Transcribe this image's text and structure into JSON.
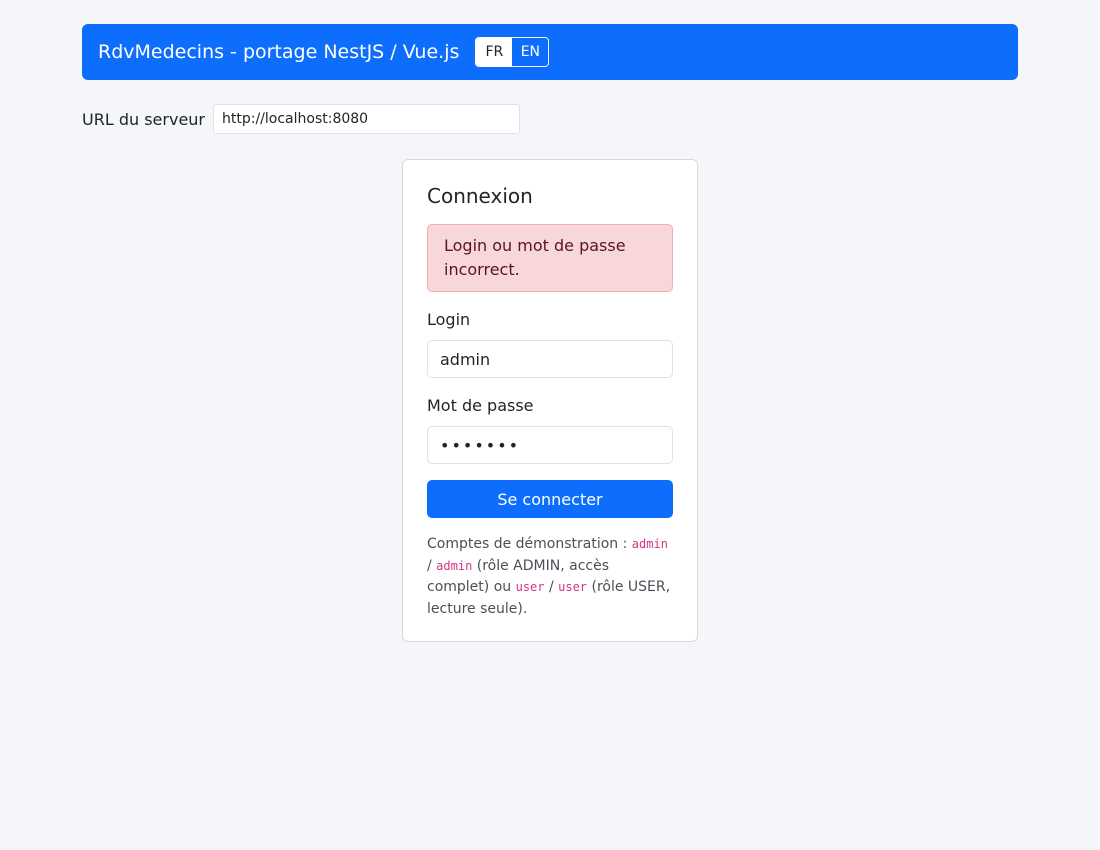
{
  "header": {
    "title": "RdvMedecins - portage NestJS / Vue.js",
    "languages": [
      "FR",
      "EN"
    ],
    "active_language": "FR"
  },
  "server": {
    "label": "URL du serveur",
    "value": "http://localhost:8080"
  },
  "login_card": {
    "title": "Connexion",
    "error": "Login ou mot de passe incorrect.",
    "login_label": "Login",
    "login_value": "admin",
    "password_label": "Mot de passe",
    "password_value": "•••••••",
    "submit_label": "Se connecter",
    "hint": {
      "prefix": "Comptes de démonstration : ",
      "admin_user": "admin",
      "sep1": " / ",
      "admin_pass": "admin",
      "admin_desc": " (rôle ADMIN, accès complet) ou ",
      "user_user": "user",
      "sep2": " / ",
      "user_pass": "user",
      "user_desc": " (rôle USER, lecture seule)."
    }
  },
  "colors": {
    "primary": "#0d6efd",
    "alert_bg": "#f8d7da",
    "alert_text": "#58151c",
    "code": "#d63384"
  }
}
